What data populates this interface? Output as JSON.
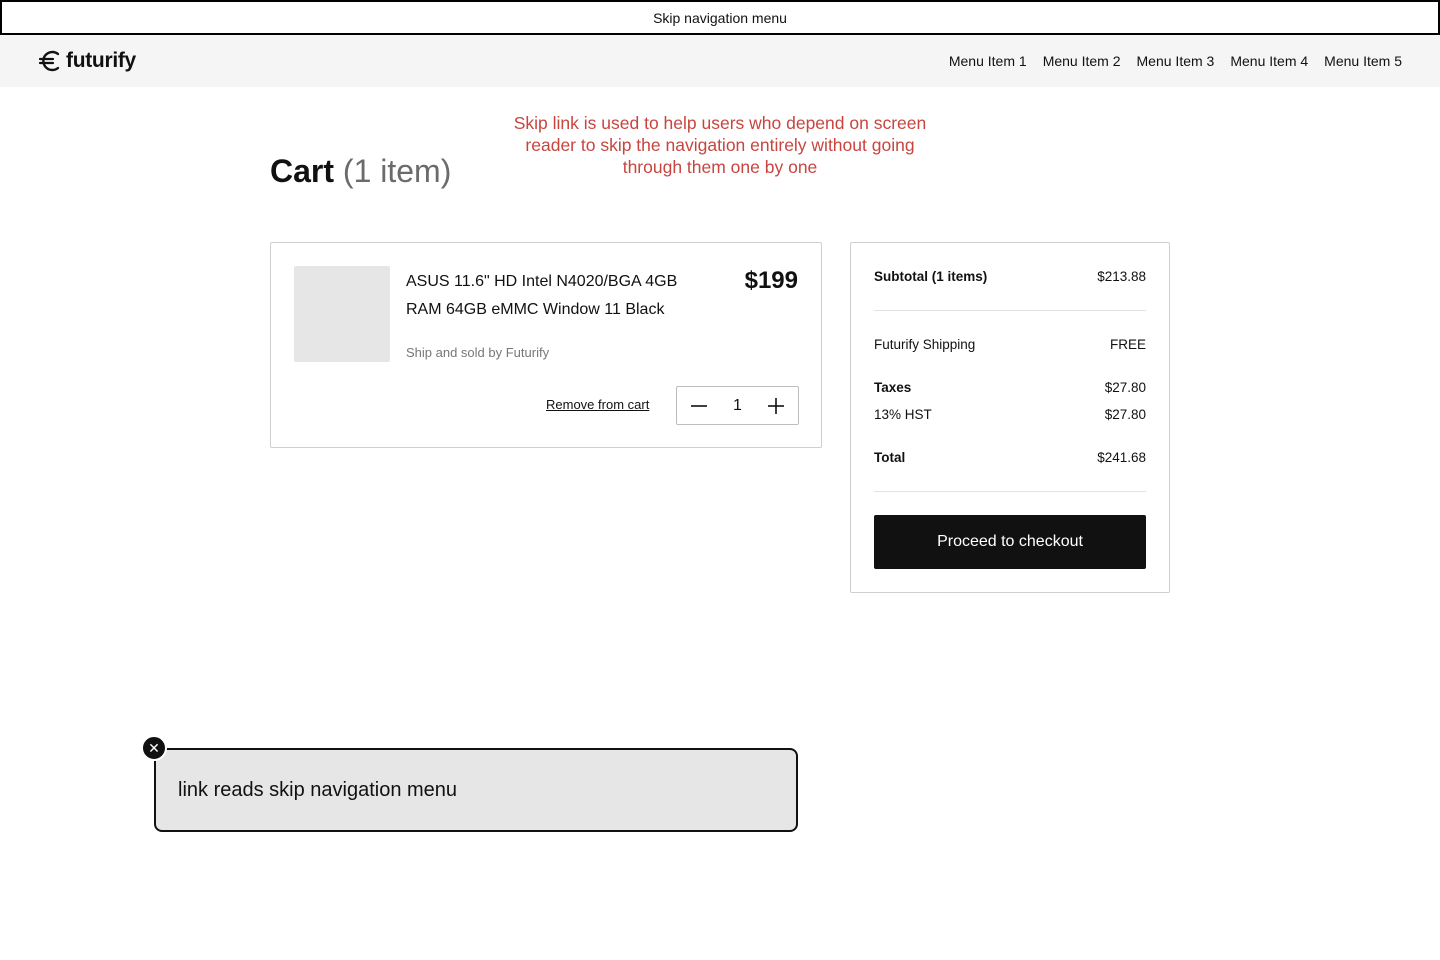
{
  "skip_link": {
    "label": "Skip navigation menu"
  },
  "header": {
    "logo_text": "futurify",
    "nav": [
      {
        "label": "Menu Item 1"
      },
      {
        "label": "Menu Item 2"
      },
      {
        "label": "Menu Item 3"
      },
      {
        "label": "Menu Item 4"
      },
      {
        "label": "Menu Item 5"
      }
    ]
  },
  "annotation": {
    "text": "Skip link is used to help users who depend on screen reader to skip the navigation entirely without going through them one by one",
    "color": "#c8453f"
  },
  "cart": {
    "title": "Cart",
    "count": "(1 item)",
    "item": {
      "name": "ASUS 11.6\" HD Intel N4020/BGA 4GB RAM 64GB eMMC Window 11 Black",
      "price": "$199",
      "seller": "Ship and sold by Futurify",
      "remove_label": "Remove from cart",
      "quantity": "1"
    }
  },
  "summary": {
    "subtotal_label": "Subtotal (1 items)",
    "subtotal_value": "$213.88",
    "shipping_label": "Futurify Shipping",
    "shipping_value": "FREE",
    "taxes_label": "Taxes",
    "taxes_value": "$27.80",
    "hst_label": "13% HST",
    "hst_value": "$27.80",
    "total_label": "Total",
    "total_value": "$241.68",
    "checkout_label": "Proceed to checkout"
  },
  "screen_reader": {
    "text": "link reads skip navigation menu",
    "close_glyph": "✕"
  }
}
